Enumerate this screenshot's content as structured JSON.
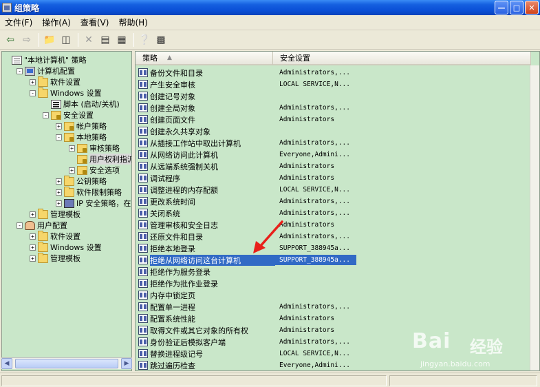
{
  "window": {
    "title": "组策略"
  },
  "menu": [
    "文件(F)",
    "操作(A)",
    "查看(V)",
    "帮助(H)"
  ],
  "tree": [
    {
      "label": "\"本地计算机\" 策略",
      "level": 0,
      "icon": "policy-icon",
      "expander": ""
    },
    {
      "label": "计算机配置",
      "level": 1,
      "icon": "computer-icon",
      "expander": "-"
    },
    {
      "label": "软件设置",
      "level": 2,
      "icon": "folder-icon",
      "expander": "+"
    },
    {
      "label": "Windows 设置",
      "level": 2,
      "icon": "folder-icon",
      "expander": "-"
    },
    {
      "label": "脚本 (启动/关机)",
      "level": 3,
      "icon": "script-icon",
      "expander": ""
    },
    {
      "label": "安全设置",
      "level": 3,
      "icon": "lock-folder-icon",
      "expander": "-"
    },
    {
      "label": "帐户策略",
      "level": 4,
      "icon": "lock-folder-icon",
      "expander": "+"
    },
    {
      "label": "本地策略",
      "level": 4,
      "icon": "lock-folder-icon",
      "expander": "-"
    },
    {
      "label": "审核策略",
      "level": 5,
      "icon": "lock-folder-icon",
      "expander": "+"
    },
    {
      "label": "用户权利指派",
      "level": 5,
      "icon": "lock-folder-icon",
      "expander": "",
      "selected": true
    },
    {
      "label": "安全选项",
      "level": 5,
      "icon": "lock-folder-icon",
      "expander": "+"
    },
    {
      "label": "公钥策略",
      "level": 4,
      "icon": "folder-icon",
      "expander": "+"
    },
    {
      "label": "软件限制策略",
      "level": 4,
      "icon": "folder-icon",
      "expander": "+"
    },
    {
      "label": "IP 安全策略，在",
      "level": 4,
      "icon": "ip-icon",
      "expander": "+"
    },
    {
      "label": "管理模板",
      "level": 2,
      "icon": "folder-icon",
      "expander": "+"
    },
    {
      "label": "用户配置",
      "level": 1,
      "icon": "user-icon",
      "expander": "-"
    },
    {
      "label": "软件设置",
      "level": 2,
      "icon": "folder-icon",
      "expander": "+"
    },
    {
      "label": "Windows 设置",
      "level": 2,
      "icon": "folder-icon",
      "expander": "+"
    },
    {
      "label": "管理模板",
      "level": 2,
      "icon": "folder-icon",
      "expander": "+"
    }
  ],
  "columns": {
    "policy": "策略",
    "setting": "安全设置"
  },
  "policies": [
    {
      "name": "备份文件和目录",
      "value": "Administrators,..."
    },
    {
      "name": "产生安全审核",
      "value": "LOCAL SERVICE,N..."
    },
    {
      "name": "创建记号对象",
      "value": ""
    },
    {
      "name": "创建全局对象",
      "value": "Administrators,..."
    },
    {
      "name": "创建页面文件",
      "value": "Administrators"
    },
    {
      "name": "创建永久共享对象",
      "value": ""
    },
    {
      "name": "从插接工作站中取出计算机",
      "value": "Administrators,..."
    },
    {
      "name": "从网络访问此计算机",
      "value": "Everyone,Admini..."
    },
    {
      "name": "从远端系统强制关机",
      "value": "Administrators"
    },
    {
      "name": "调试程序",
      "value": "Administrators"
    },
    {
      "name": "调整进程的内存配额",
      "value": "LOCAL SERVICE,N..."
    },
    {
      "name": "更改系统时间",
      "value": "Administrators,..."
    },
    {
      "name": "关闭系统",
      "value": "Administrators,..."
    },
    {
      "name": "管理审核和安全日志",
      "value": "Administrators"
    },
    {
      "name": "还原文件和目录",
      "value": "Administrators,..."
    },
    {
      "name": "拒绝本地登录",
      "value": "SUPPORT_388945a..."
    },
    {
      "name": "拒绝从网络访问这台计算机",
      "value": "SUPPORT_388945a...",
      "selected": true
    },
    {
      "name": "拒绝作为服务登录",
      "value": ""
    },
    {
      "name": "拒绝作为批作业登录",
      "value": ""
    },
    {
      "name": "内存中锁定页",
      "value": ""
    },
    {
      "name": "配置单一进程",
      "value": "Administrators,..."
    },
    {
      "name": "配置系统性能",
      "value": "Administrators"
    },
    {
      "name": "取得文件或其它对象的所有权",
      "value": "Administrators"
    },
    {
      "name": "身份验证后模拟客户端",
      "value": "Administrators,..."
    },
    {
      "name": "替换进程级记号",
      "value": "LOCAL SERVICE,N..."
    },
    {
      "name": "跳过遍历检查",
      "value": "Everyone,Admini..."
    }
  ],
  "watermark": {
    "brand": "Bai",
    "brand_cn": "经验",
    "url": "jingyan.baidu.com"
  },
  "colors": {
    "selection": "#316ac5",
    "pane_bg": "#c9e7c9",
    "arrow": "#e8201a"
  }
}
